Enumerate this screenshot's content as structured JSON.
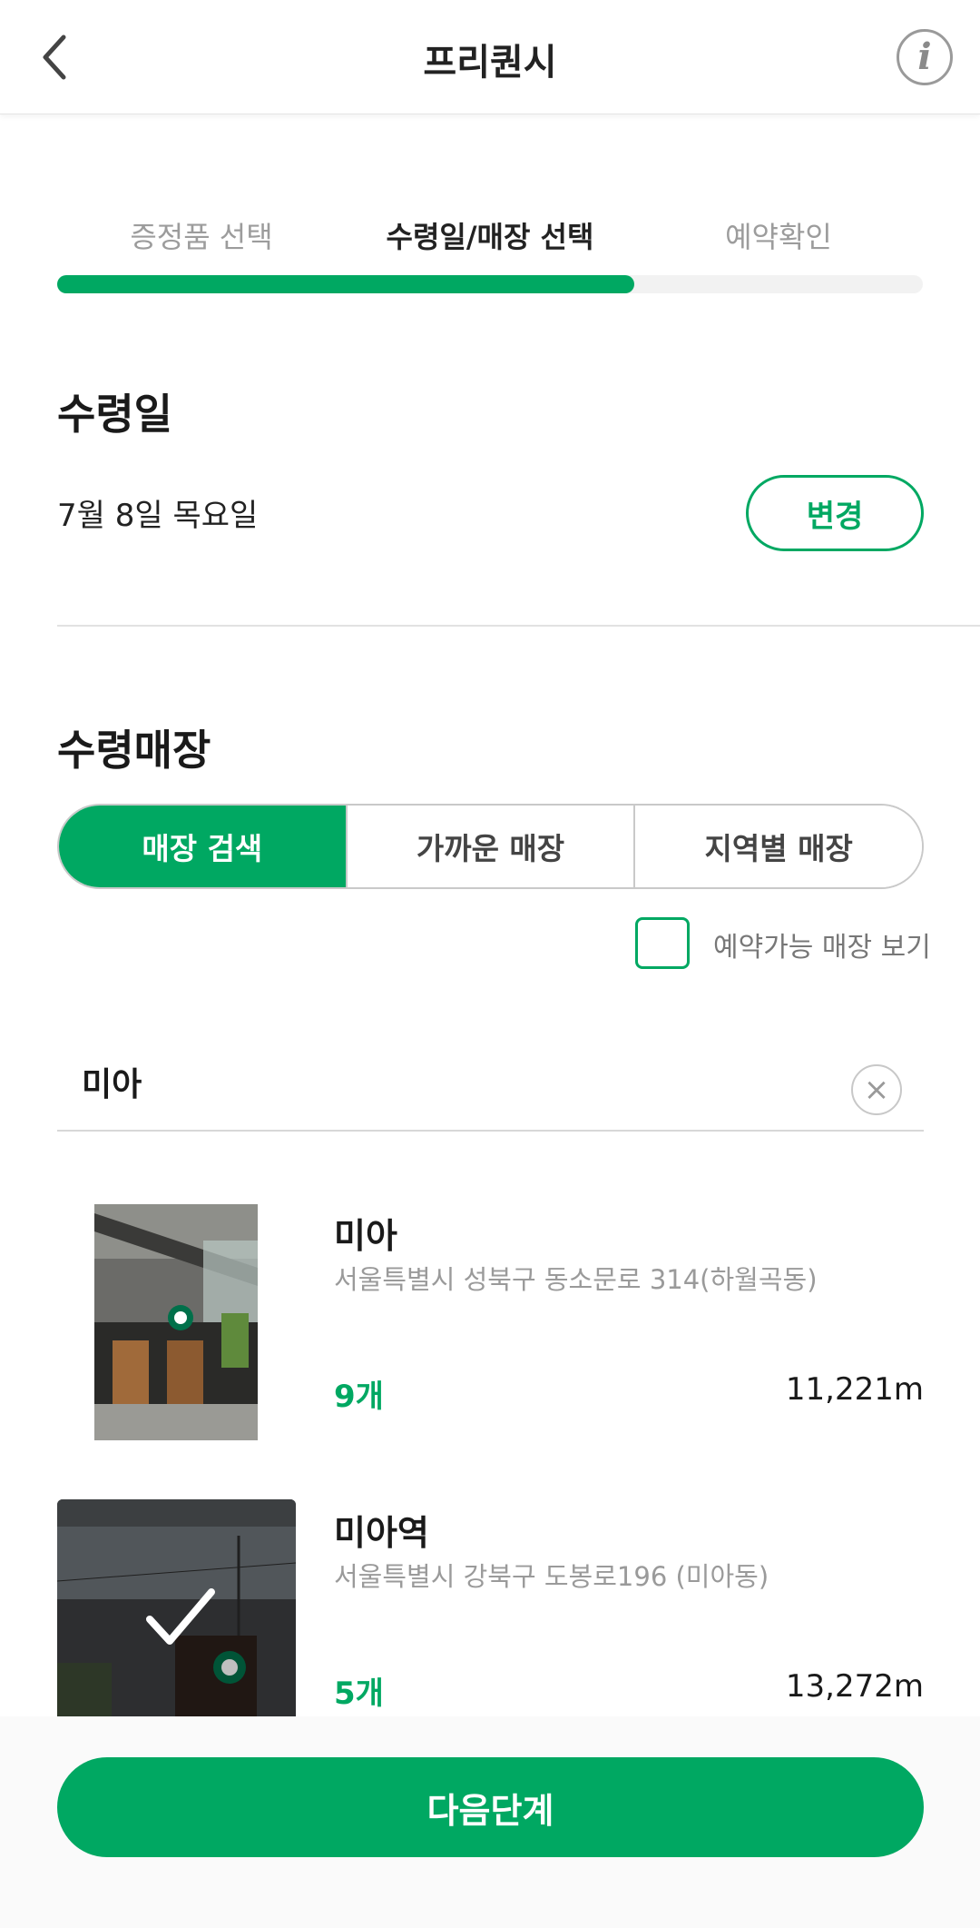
{
  "header": {
    "title": "프리퀀시",
    "back_icon": "chevron-left-icon",
    "info_icon": "info-icon",
    "info_glyph": "i"
  },
  "steps": [
    {
      "label": "증정품 선택",
      "active": false
    },
    {
      "label": "수령일/매장 선택",
      "active": true
    },
    {
      "label": "예약확인",
      "active": false
    }
  ],
  "progress": {
    "fraction": 0.667,
    "color": "#00a862"
  },
  "pickup_date": {
    "title": "수령일",
    "value": "7월 8일 목요일",
    "change_label": "변경"
  },
  "pickup_store": {
    "title": "수령매장",
    "tabs": [
      {
        "label": "매장 검색",
        "active": true
      },
      {
        "label": "가까운 매장",
        "active": false
      },
      {
        "label": "지역별 매장",
        "active": false
      }
    ],
    "available_only_label": "예약가능 매장 보기",
    "available_only_checked": false
  },
  "search": {
    "value": "미아",
    "clear_glyph": "×"
  },
  "stores": [
    {
      "name": "미아",
      "address": "서울특별시 성북구 동소문로 314(하월곡동)",
      "count": "9개",
      "distance": "11,221m",
      "selected": false
    },
    {
      "name": "미아역",
      "address": "서울특별시 강북구 도봉로196 (미아동)",
      "count": "5개",
      "distance": "13,272m",
      "selected": true
    }
  ],
  "next_button": {
    "label": "다음단계"
  },
  "colors": {
    "accent": "#00a862",
    "text": "#1a1a1a",
    "muted": "#9a9a9a"
  }
}
